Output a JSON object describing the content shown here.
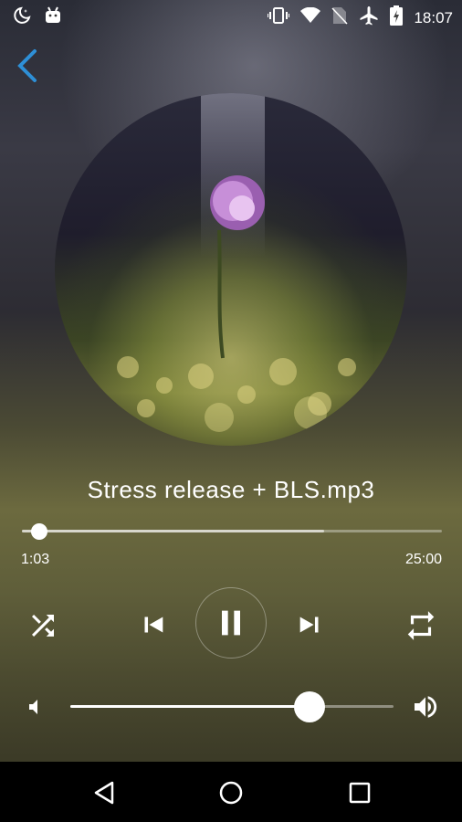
{
  "status_bar": {
    "time": "18:07",
    "left_icons": [
      "night-mode-icon",
      "android-icon"
    ],
    "right_icons": [
      "vibrate-icon",
      "wifi-icon",
      "no-sim-icon",
      "airplane-icon",
      "battery-icon"
    ]
  },
  "nav": {
    "back_icon": "chevron-left-icon",
    "accent": "#2e8fd6"
  },
  "track": {
    "title": "Stress release + BLS.mp3",
    "elapsed": "1:03",
    "duration": "25:00",
    "progress": 0.042,
    "buffered": 0.72
  },
  "controls": {
    "shuffle_icon": "shuffle-icon",
    "previous_icon": "skip-previous-icon",
    "play_pause_icon": "pause-icon",
    "next_icon": "skip-next-icon",
    "repeat_icon": "repeat-icon"
  },
  "volume": {
    "level": 0.74,
    "low_icon": "volume-low-icon",
    "high_icon": "volume-high-icon"
  },
  "system_nav": [
    "back-triangle-icon",
    "home-circle-icon",
    "recents-square-icon"
  ]
}
